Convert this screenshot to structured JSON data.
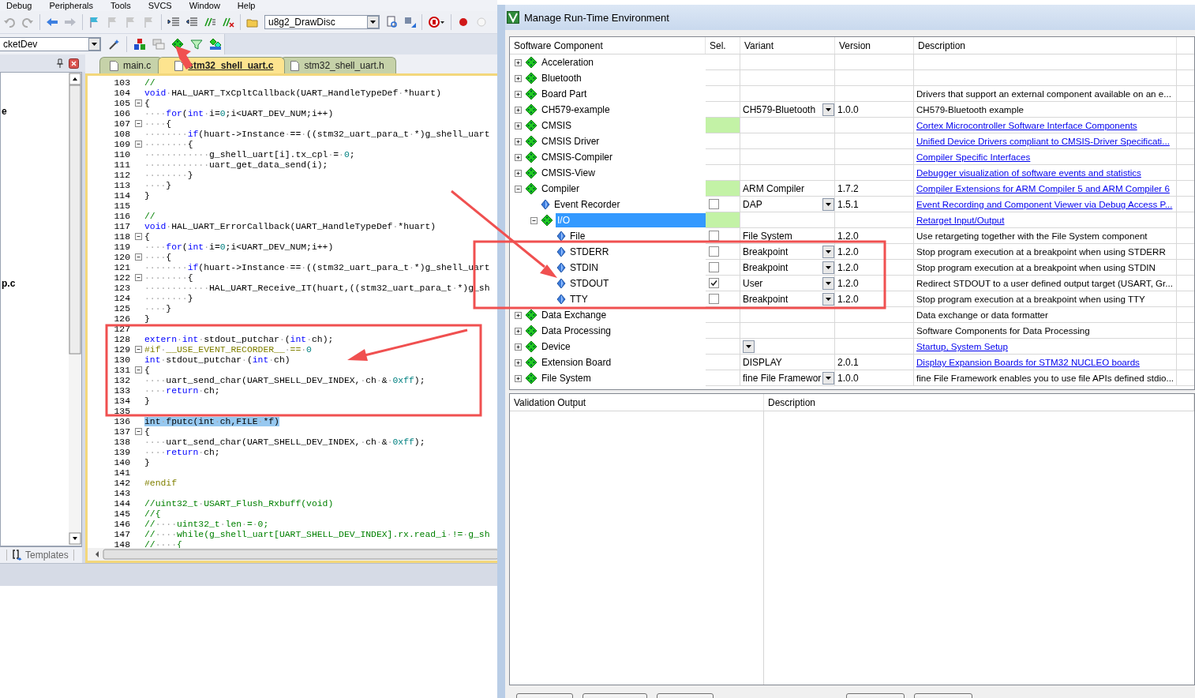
{
  "ide": {
    "menu": [
      "Debug",
      "Peripherals",
      "Tools",
      "SVCS",
      "Window",
      "Help"
    ],
    "target_combo": "u8g2_DrawDisc",
    "project_combo": "cketDev",
    "project_pane": {
      "items": [
        "e",
        "p.c"
      ],
      "tab": "Templates"
    },
    "tabs": [
      {
        "label": "main.c",
        "selected": false
      },
      {
        "label": "stm32_shell_uart.c",
        "selected": true
      },
      {
        "label": "stm32_shell_uart.h",
        "selected": false
      }
    ],
    "code_lines": [
      {
        "number": "103",
        "fold_toggle": false,
        "segments": [
          {
            "kind": "comment",
            "text": "//"
          }
        ]
      },
      {
        "number": "104",
        "fold_toggle": false,
        "segments": [
          {
            "kind": "keyword",
            "text": "void"
          },
          {
            "kind": "plain",
            "text": "·HAL_UART_TxCpltCallback(UART_HandleTypeDef·*huart)"
          }
        ]
      },
      {
        "number": "105",
        "fold_toggle": true,
        "segments": [
          {
            "kind": "plain",
            "text": "{"
          }
        ]
      },
      {
        "number": "106",
        "fold_toggle": false,
        "segments": [
          {
            "kind": "plain",
            "text": "····"
          },
          {
            "kind": "keyword",
            "text": "for"
          },
          {
            "kind": "plain",
            "text": "("
          },
          {
            "kind": "keyword",
            "text": "int"
          },
          {
            "kind": "plain",
            "text": "·i="
          },
          {
            "kind": "number",
            "text": "0"
          },
          {
            "kind": "plain",
            "text": ";i<UART_DEV_NUM;i++)"
          }
        ]
      },
      {
        "number": "107",
        "fold_toggle": true,
        "segments": [
          {
            "kind": "plain",
            "text": "····{"
          }
        ]
      },
      {
        "number": "108",
        "fold_toggle": false,
        "segments": [
          {
            "kind": "plain",
            "text": "········"
          },
          {
            "kind": "keyword",
            "text": "if"
          },
          {
            "kind": "plain",
            "text": "(huart->Instance·==·((stm32_uart_para_t·*)g_shell_uart"
          }
        ]
      },
      {
        "number": "109",
        "fold_toggle": true,
        "segments": [
          {
            "kind": "plain",
            "text": "········{"
          }
        ]
      },
      {
        "number": "110",
        "fold_toggle": false,
        "segments": [
          {
            "kind": "plain",
            "text": "············g_shell_uart[i].tx_cpl·=·"
          },
          {
            "kind": "number",
            "text": "0"
          },
          {
            "kind": "plain",
            "text": ";"
          }
        ]
      },
      {
        "number": "111",
        "fold_toggle": false,
        "segments": [
          {
            "kind": "plain",
            "text": "············uart_get_data_send(i);"
          }
        ]
      },
      {
        "number": "112",
        "fold_toggle": false,
        "segments": [
          {
            "kind": "plain",
            "text": "········}"
          }
        ]
      },
      {
        "number": "113",
        "fold_toggle": false,
        "segments": [
          {
            "kind": "plain",
            "text": "····}"
          }
        ]
      },
      {
        "number": "114",
        "fold_toggle": false,
        "segments": [
          {
            "kind": "plain",
            "text": "}"
          }
        ]
      },
      {
        "number": "115",
        "fold_toggle": false
      },
      {
        "number": "116",
        "fold_toggle": false,
        "segments": [
          {
            "kind": "comment",
            "text": "//"
          }
        ]
      },
      {
        "number": "117",
        "fold_toggle": false,
        "segments": [
          {
            "kind": "keyword",
            "text": "void"
          },
          {
            "kind": "plain",
            "text": "·HAL_UART_ErrorCallback(UART_HandleTypeDef·*huart)"
          }
        ]
      },
      {
        "number": "118",
        "fold_toggle": true,
        "segments": [
          {
            "kind": "plain",
            "text": "{"
          }
        ]
      },
      {
        "number": "119",
        "fold_toggle": false,
        "segments": [
          {
            "kind": "plain",
            "text": "····"
          },
          {
            "kind": "keyword",
            "text": "for"
          },
          {
            "kind": "plain",
            "text": "("
          },
          {
            "kind": "keyword",
            "text": "int"
          },
          {
            "kind": "plain",
            "text": "·i="
          },
          {
            "kind": "number",
            "text": "0"
          },
          {
            "kind": "plain",
            "text": ";i<UART_DEV_NUM;i++)"
          }
        ]
      },
      {
        "number": "120",
        "fold_toggle": true,
        "segments": [
          {
            "kind": "plain",
            "text": "····{"
          }
        ]
      },
      {
        "number": "121",
        "fold_toggle": false,
        "segments": [
          {
            "kind": "plain",
            "text": "········"
          },
          {
            "kind": "keyword",
            "text": "if"
          },
          {
            "kind": "plain",
            "text": "(huart->Instance·==·((stm32_uart_para_t·*)g_shell_uart"
          }
        ]
      },
      {
        "number": "122",
        "fold_toggle": true,
        "segments": [
          {
            "kind": "plain",
            "text": "········{"
          }
        ]
      },
      {
        "number": "123",
        "fold_toggle": false,
        "segments": [
          {
            "kind": "plain",
            "text": "············HAL_UART_Receive_IT(huart,((stm32_uart_para_t·*)g_sh"
          }
        ]
      },
      {
        "number": "124",
        "fold_toggle": false,
        "segments": [
          {
            "kind": "plain",
            "text": "········}"
          }
        ]
      },
      {
        "number": "125",
        "fold_toggle": false,
        "segments": [
          {
            "kind": "plain",
            "text": "····}"
          }
        ]
      },
      {
        "number": "126",
        "fold_toggle": false,
        "segments": [
          {
            "kind": "plain",
            "text": "}"
          }
        ]
      },
      {
        "number": "127",
        "fold_toggle": false
      },
      {
        "number": "128",
        "fold_toggle": false,
        "segments": [
          {
            "kind": "keyword",
            "text": "extern"
          },
          {
            "kind": "plain",
            "text": "·"
          },
          {
            "kind": "keyword",
            "text": "int"
          },
          {
            "kind": "plain",
            "text": "·stdout_putchar·("
          },
          {
            "kind": "keyword",
            "text": "int"
          },
          {
            "kind": "plain",
            "text": "·ch);"
          }
        ]
      },
      {
        "number": "129",
        "fold_toggle": true,
        "segments": [
          {
            "kind": "preprocessor",
            "text": "#if·__USE_EVENT_RECORDER__·==·"
          },
          {
            "kind": "number",
            "text": "0"
          }
        ]
      },
      {
        "number": "130",
        "fold_toggle": false,
        "segments": [
          {
            "kind": "keyword",
            "text": "int"
          },
          {
            "kind": "plain",
            "text": "·stdout_putchar·("
          },
          {
            "kind": "keyword",
            "text": "int"
          },
          {
            "kind": "plain",
            "text": "·ch)"
          }
        ]
      },
      {
        "number": "131",
        "fold_toggle": true,
        "segments": [
          {
            "kind": "plain",
            "text": "{"
          }
        ]
      },
      {
        "number": "132",
        "fold_toggle": false,
        "segments": [
          {
            "kind": "plain",
            "text": "····uart_send_char(UART_SHELL_DEV_INDEX,·ch·&·"
          },
          {
            "kind": "number",
            "text": "0xff"
          },
          {
            "kind": "plain",
            "text": ");"
          }
        ]
      },
      {
        "number": "133",
        "fold_toggle": false,
        "segments": [
          {
            "kind": "plain",
            "text": "····"
          },
          {
            "kind": "keyword",
            "text": "return"
          },
          {
            "kind": "plain",
            "text": "·ch;"
          }
        ]
      },
      {
        "number": "134",
        "fold_toggle": false,
        "segments": [
          {
            "kind": "plain",
            "text": "}"
          }
        ]
      },
      {
        "number": "135",
        "fold_toggle": false
      },
      {
        "number": "136",
        "fold_toggle": false,
        "selected": true,
        "segments": [
          {
            "kind": "plain",
            "text": "int·fputc(int·ch,FILE·*f)"
          }
        ]
      },
      {
        "number": "137",
        "fold_toggle": true,
        "segments": [
          {
            "kind": "plain",
            "text": "{"
          }
        ]
      },
      {
        "number": "138",
        "fold_toggle": false,
        "segments": [
          {
            "kind": "plain",
            "text": "····uart_send_char(UART_SHELL_DEV_INDEX,·ch·&·"
          },
          {
            "kind": "number",
            "text": "0xff"
          },
          {
            "kind": "plain",
            "text": ");"
          }
        ]
      },
      {
        "number": "139",
        "fold_toggle": false,
        "segments": [
          {
            "kind": "plain",
            "text": "····"
          },
          {
            "kind": "keyword",
            "text": "return"
          },
          {
            "kind": "plain",
            "text": "·ch;"
          }
        ]
      },
      {
        "number": "140",
        "fold_toggle": false,
        "segments": [
          {
            "kind": "plain",
            "text": "}"
          }
        ]
      },
      {
        "number": "141",
        "fold_toggle": false
      },
      {
        "number": "142",
        "fold_toggle": false,
        "segments": [
          {
            "kind": "preprocessor",
            "text": "#endif"
          }
        ]
      },
      {
        "number": "143",
        "fold_toggle": false
      },
      {
        "number": "144",
        "fold_toggle": false,
        "segments": [
          {
            "kind": "comment",
            "text": "//uint32_t·USART_Flush_Rxbuff(void)"
          }
        ]
      },
      {
        "number": "145",
        "fold_toggle": false,
        "segments": [
          {
            "kind": "comment",
            "text": "//{"
          }
        ]
      },
      {
        "number": "146",
        "fold_toggle": false,
        "segments": [
          {
            "kind": "comment",
            "text": "//····uint32_t·len·=·0;"
          }
        ]
      },
      {
        "number": "147",
        "fold_toggle": false,
        "segments": [
          {
            "kind": "comment",
            "text": "//····while(g_shell_uart[UART_SHELL_DEV_INDEX].rx.read_i·!=·g_sh"
          }
        ]
      },
      {
        "number": "148",
        "fold_toggle": false,
        "segments": [
          {
            "kind": "comment",
            "text": "//····{"
          }
        ]
      }
    ]
  },
  "dialog": {
    "title": "Manage Run-Time Environment",
    "columns": [
      "Software Component",
      "Sel.",
      "Variant",
      "Version",
      "Description"
    ],
    "components": [
      {
        "name": "Acceleration",
        "expanded": false,
        "selected": false
      },
      {
        "name": "Bluetooth",
        "expanded": false,
        "selected": false
      },
      {
        "name": "Board Part",
        "expanded": false,
        "selected": false,
        "description": "Drivers that support an external component available on an e...",
        "description_link": false
      },
      {
        "name": "CH579-example",
        "expanded": false,
        "selected": false,
        "variant": "CH579-Bluetooth",
        "variant_dropdown": true,
        "version": "1.0.0",
        "description": "CH579-Bluetooth example",
        "description_link": false
      },
      {
        "name": "CMSIS",
        "expanded": false,
        "selected": false,
        "fulfilled": true,
        "description": "Cortex Microcontroller Software Interface Components",
        "description_link": true
      },
      {
        "name": "CMSIS Driver",
        "expanded": false,
        "selected": false,
        "description": "Unified Device Drivers compliant to CMSIS-Driver Specificati...",
        "description_link": true
      },
      {
        "name": "CMSIS-Compiler",
        "expanded": false,
        "selected": false,
        "description": "Compiler Specific Interfaces",
        "description_link": true
      },
      {
        "name": "CMSIS-View",
        "expanded": false,
        "selected": false,
        "description": "Debugger visualization of software events and statistics",
        "description_link": true
      },
      {
        "name": "Compiler",
        "expanded": true,
        "selected": false,
        "fulfilled": true,
        "variant": "ARM Compiler",
        "variant_dropdown": false,
        "version": "1.7.2",
        "description": "Compiler Extensions for ARM Compiler 5 and ARM Compiler 6",
        "description_link": true,
        "children": [
          {
            "name": "Event Recorder",
            "selected": false,
            "checked": false,
            "variant": "DAP",
            "variant_dropdown": true,
            "version": "1.5.1",
            "description": "Event Recording and Component Viewer via Debug Access P...",
            "description_link": true
          },
          {
            "name": "I/O",
            "expanded": true,
            "selected": true,
            "fulfilled": true,
            "description": "Retarget Input/Output",
            "description_link": true,
            "children": [
              {
                "name": "File",
                "selected": false,
                "checked": false,
                "variant": "File System",
                "variant_dropdown": false,
                "version": "1.2.0",
                "description": "Use retargeting together with the File System component",
                "description_link": false
              },
              {
                "name": "STDERR",
                "selected": false,
                "checked": false,
                "variant": "Breakpoint",
                "variant_dropdown": true,
                "version": "1.2.0",
                "description": "Stop program execution at a breakpoint when using STDERR",
                "description_link": false
              },
              {
                "name": "STDIN",
                "selected": false,
                "checked": false,
                "variant": "Breakpoint",
                "variant_dropdown": true,
                "version": "1.2.0",
                "description": "Stop program execution at a breakpoint when using STDIN",
                "description_link": false
              },
              {
                "name": "STDOUT",
                "selected": false,
                "checked": true,
                "variant": "User",
                "variant_dropdown": true,
                "version": "1.2.0",
                "description": "Redirect STDOUT to a user defined output target (USART, Gr...",
                "description_link": false
              },
              {
                "name": "TTY",
                "selected": false,
                "checked": false,
                "variant": "Breakpoint",
                "variant_dropdown": true,
                "version": "1.2.0",
                "description": "Stop program execution at a breakpoint when using TTY",
                "description_link": false
              }
            ]
          }
        ]
      },
      {
        "name": "Data Exchange",
        "expanded": false,
        "selected": false,
        "description": "Data exchange or data formatter",
        "description_link": false
      },
      {
        "name": "Data Processing",
        "expanded": false,
        "selected": false,
        "description": "Software Components for Data Processing",
        "description_link": false
      },
      {
        "name": "Device",
        "expanded": false,
        "selected": false,
        "variant_dropdown": true,
        "description": "Startup, System Setup",
        "description_link": true
      },
      {
        "name": "Extension Board",
        "expanded": false,
        "selected": false,
        "variant": "DISPLAY",
        "variant_dropdown": false,
        "version": "2.0.1",
        "description": "Display Expansion Boards for STM32 NUCLEO boards",
        "description_link": true
      },
      {
        "name": "File System",
        "expanded": false,
        "selected": false,
        "variant": "fine File Framewor",
        "variant_dropdown": true,
        "version": "1.0.0",
        "description": "fine File Framework enables you to use file APIs defined stdio...",
        "description_link": false
      }
    ],
    "validation_columns": [
      "Validation Output",
      "Description"
    ]
  }
}
